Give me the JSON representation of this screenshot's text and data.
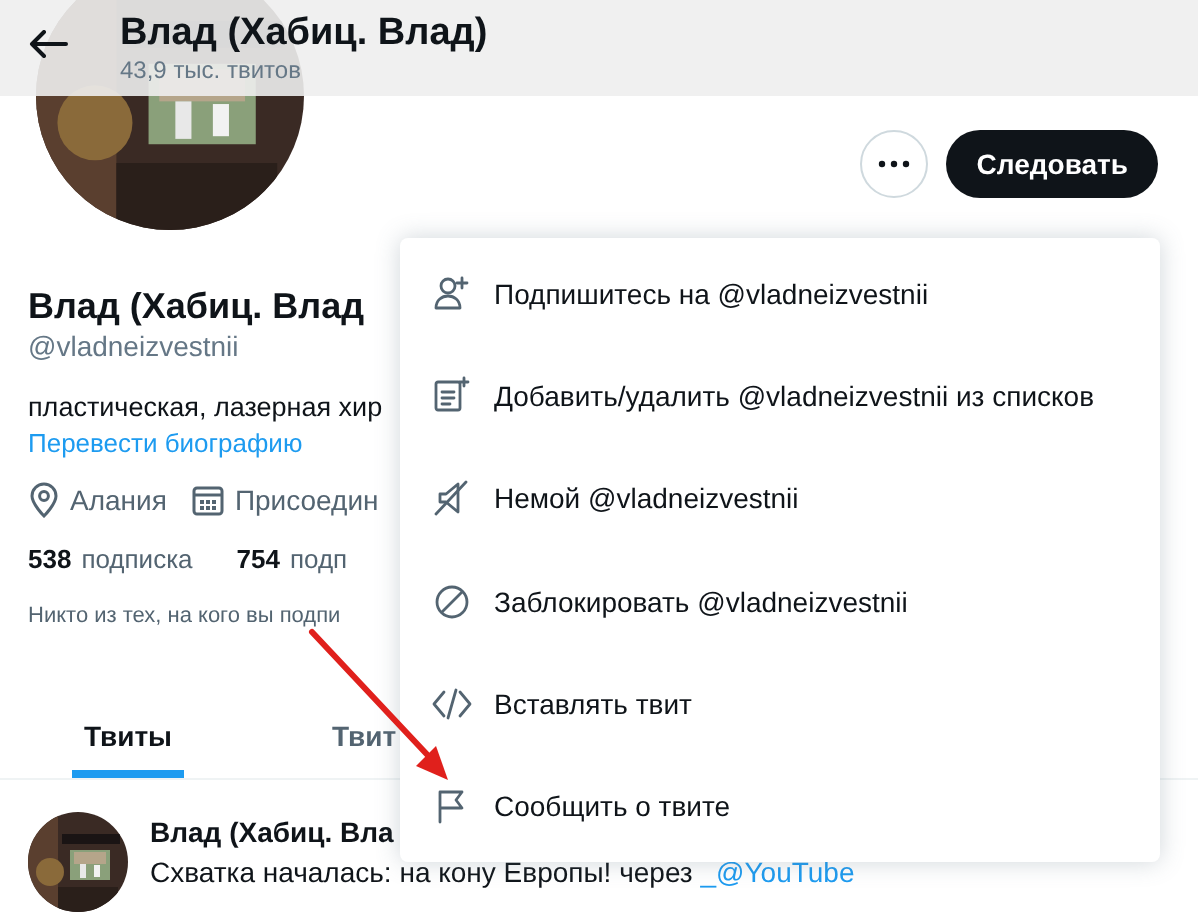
{
  "header": {
    "title": "Влад (Хабиц. Влад)",
    "subtitle": "43,9 тыс. твитов"
  },
  "profile": {
    "name": "Влад (Хабиц. Влад",
    "handle": "@vladneizvestnii",
    "bio": "пластическая, лазерная хир",
    "translate_link": "Перевести биографию",
    "location": "Алания",
    "joined": "Присоедин",
    "following_count": "538",
    "following_label": "подписка",
    "followers_count": "754",
    "followers_label": "подп",
    "followed_by_note": "Никто из тех, на кого вы подпи"
  },
  "actions": {
    "follow_button": "Следовать"
  },
  "tabs": [
    {
      "label": "Твиты",
      "selected": true
    },
    {
      "label": "Твит",
      "selected": false
    }
  ],
  "tweet": {
    "author": "Влад (Хабиц. Вла",
    "text": "Схватка началась: на кону Европы!  через ",
    "link": "_@YouTube"
  },
  "menu": {
    "items": [
      {
        "kind": "follow",
        "label": "Подпишитесь на @vladneizvestnii"
      },
      {
        "kind": "list",
        "label": "Добавить/удалить @vladneizvestnii из списков"
      },
      {
        "kind": "mute",
        "label": "Немой @vladneizvestnii"
      },
      {
        "kind": "block",
        "label": "Заблокировать @vladneizvestnii"
      },
      {
        "kind": "embed",
        "label": "Вставлять твит"
      },
      {
        "kind": "report",
        "label": "Сообщить о твите"
      }
    ]
  }
}
